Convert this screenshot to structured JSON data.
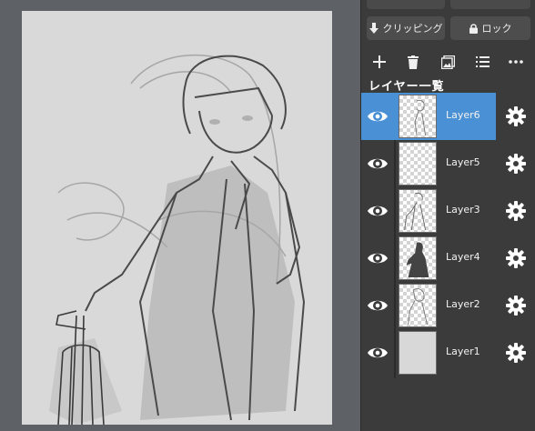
{
  "toolbar_top": {
    "clipping_label": "クリッピング",
    "lock_label": "ロック"
  },
  "layer_tools": {
    "icons": [
      "plus-icon",
      "trash-icon",
      "image-icon",
      "list-icon",
      "more-icon"
    ]
  },
  "layer_panel": {
    "title": "レイヤー一覧",
    "layers": [
      {
        "name": "Layer6",
        "selected": true,
        "visible": true
      },
      {
        "name": "Layer5",
        "selected": false,
        "visible": true
      },
      {
        "name": "Layer3",
        "selected": false,
        "visible": true
      },
      {
        "name": "Layer4",
        "selected": false,
        "visible": true
      },
      {
        "name": "Layer2",
        "selected": false,
        "visible": true
      },
      {
        "name": "Layer1",
        "selected": false,
        "visible": true
      }
    ]
  },
  "colors": {
    "selected": "#4a90d4",
    "panel_bg": "#3b3b3b",
    "canvas_bg": "#5e6266"
  }
}
